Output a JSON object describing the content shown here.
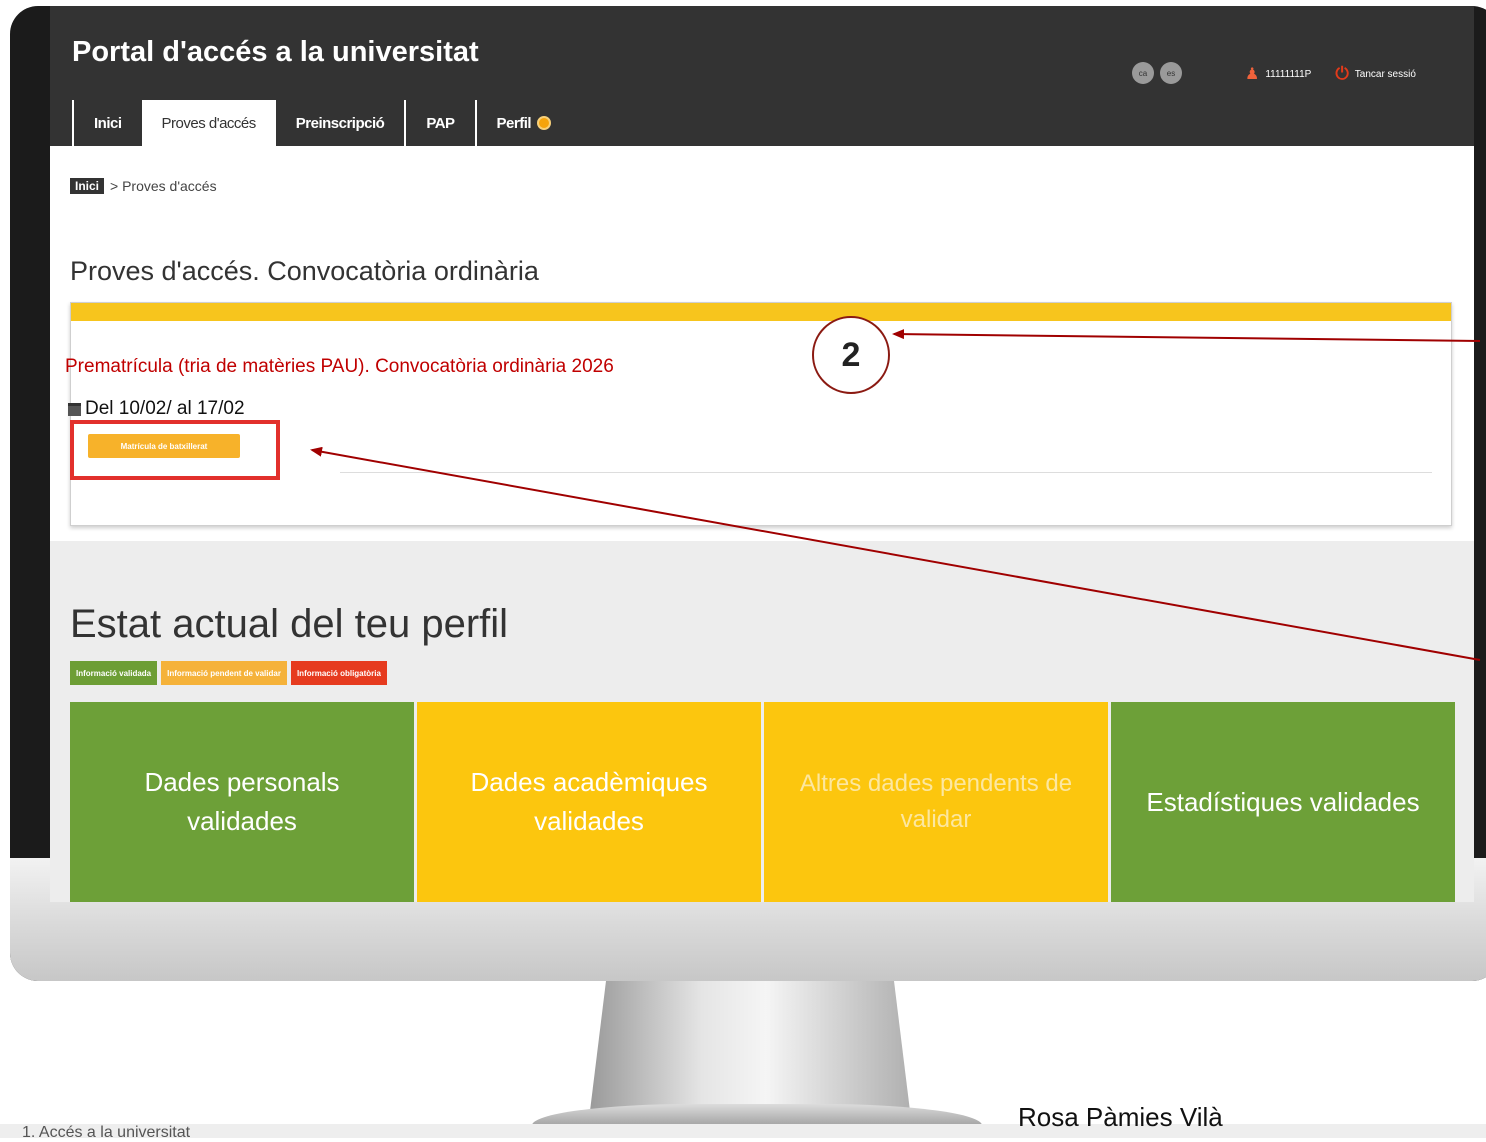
{
  "header": {
    "title": "Portal d'accés a la universitat",
    "languages": [
      "ca",
      "es"
    ],
    "user_id": "11111111P",
    "logout_label": "Tancar sessió"
  },
  "tabs": [
    {
      "label": "Inici"
    },
    {
      "label": "Proves d'accés"
    },
    {
      "label": "Preinscripció"
    },
    {
      "label": "PAP"
    },
    {
      "label": "Perfil"
    }
  ],
  "breadcrumb": {
    "home": "Inici",
    "current": "> Proves d'accés"
  },
  "section": {
    "title": "Proves d'accés. Convocatòria ordinària"
  },
  "card": {
    "link": "Prematrícula (tria de matèries PAU). Convocatòria ordinària 2026",
    "date": "Del 10/02/ al 17/02",
    "badge": "Matrícula de batxillerat"
  },
  "profile": {
    "title": "Estat actual del teu perfil",
    "legend": [
      {
        "label": "Informació validada",
        "color": "#6d9e35"
      },
      {
        "label": "Informació pendent de validar",
        "color": "#f5b23a"
      },
      {
        "label": "Informació obligatòria",
        "color": "#e63b1f"
      }
    ],
    "tiles": [
      {
        "label": "Dades personals validades",
        "color": "#6da038"
      },
      {
        "label": "Dades acadèmiques validades",
        "color": "#fcc60e"
      },
      {
        "label": "Altres dades pendents de validar",
        "color": "#fcc60e"
      },
      {
        "label": "Estadístiques validades",
        "color": "#6da038"
      }
    ]
  },
  "annotations": {
    "step_number": "2",
    "highlight_color": "#e2302c",
    "arrow_color": "#a00000"
  },
  "footer": {
    "left": "1. Accés a la universitat",
    "author": "Rosa Pàmies Vilà"
  }
}
